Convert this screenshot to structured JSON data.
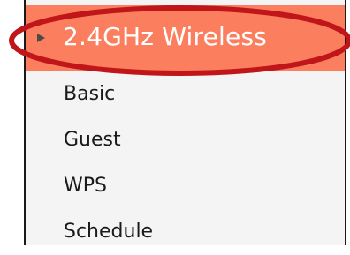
{
  "menu": {
    "header": {
      "label": "2.4GHz Wireless",
      "expand_icon": "triangle-right-icon",
      "highlight_color": "#fb7f5f",
      "annotation_color": "#c0161a"
    },
    "items": [
      {
        "label": "Basic"
      },
      {
        "label": "Guest"
      },
      {
        "label": "WPS"
      },
      {
        "label": "Schedule"
      }
    ]
  }
}
